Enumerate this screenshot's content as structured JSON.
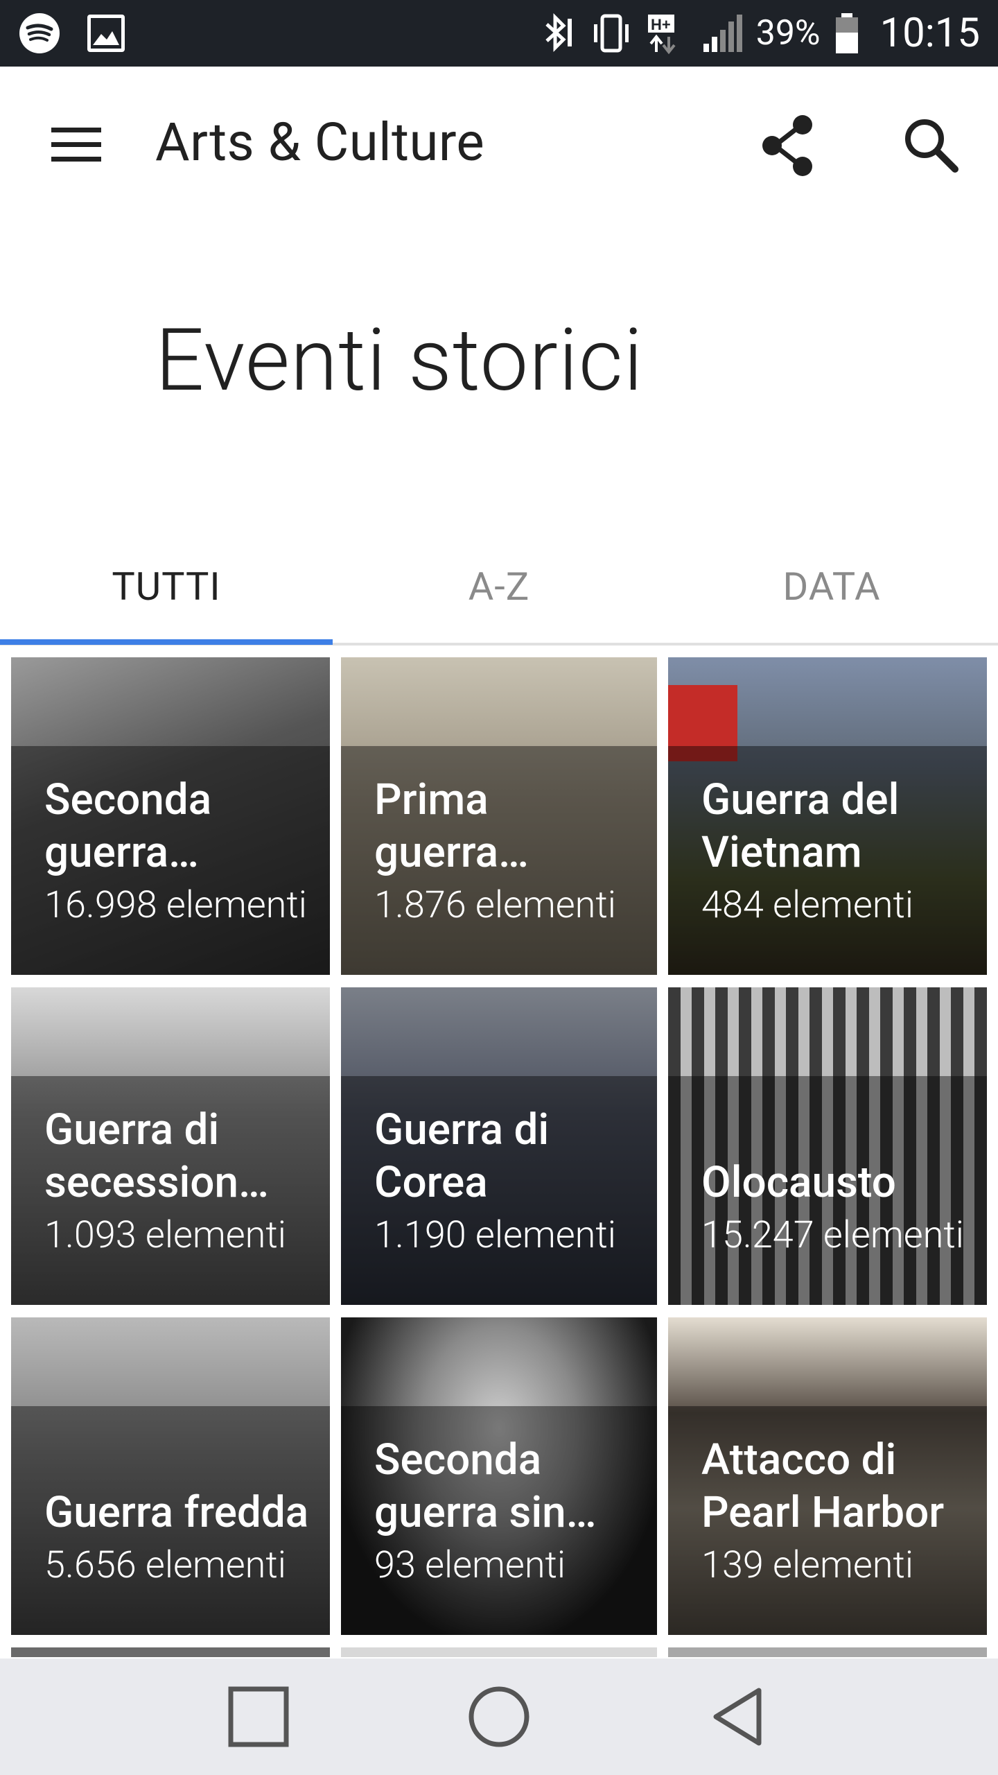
{
  "status_bar": {
    "battery": "39%",
    "time": "10:15",
    "icons": [
      "spotify-icon",
      "gallery-icon",
      "bluetooth-icon",
      "vibrate-icon",
      "hplus-data-icon",
      "signal-icon",
      "battery-icon"
    ]
  },
  "app_bar": {
    "title": "Arts & Culture",
    "icons": [
      "menu-icon",
      "share-icon",
      "search-icon"
    ]
  },
  "page": {
    "title": "Eventi storici"
  },
  "tabs": [
    {
      "label": "TUTTI",
      "selected": true
    },
    {
      "label": "A-Z",
      "selected": false
    },
    {
      "label": "DATA",
      "selected": false
    }
  ],
  "accent_color": "#3d7fe6",
  "tiles": [
    {
      "title": "Seconda guerra…",
      "count": "16.998 elementi"
    },
    {
      "title": "Prima guerra…",
      "count": "1.876 elementi"
    },
    {
      "title": "Guerra del Vietnam",
      "count": "484 elementi"
    },
    {
      "title": "Guerra di secession…",
      "count": "1.093 elementi"
    },
    {
      "title": "Guerra di Corea",
      "count": "1.190 elementi"
    },
    {
      "title": "Olocausto",
      "count": "15.247 elementi"
    },
    {
      "title": "Guerra fredda",
      "count": "5.656 elementi"
    },
    {
      "title": "Seconda guerra sin…",
      "count": "93 elementi"
    },
    {
      "title": "Attacco di Pearl Harbor",
      "count": "139 elementi"
    }
  ],
  "nav_bar": {
    "icons": [
      "recents-square-icon",
      "home-circle-icon",
      "back-triangle-icon"
    ]
  }
}
